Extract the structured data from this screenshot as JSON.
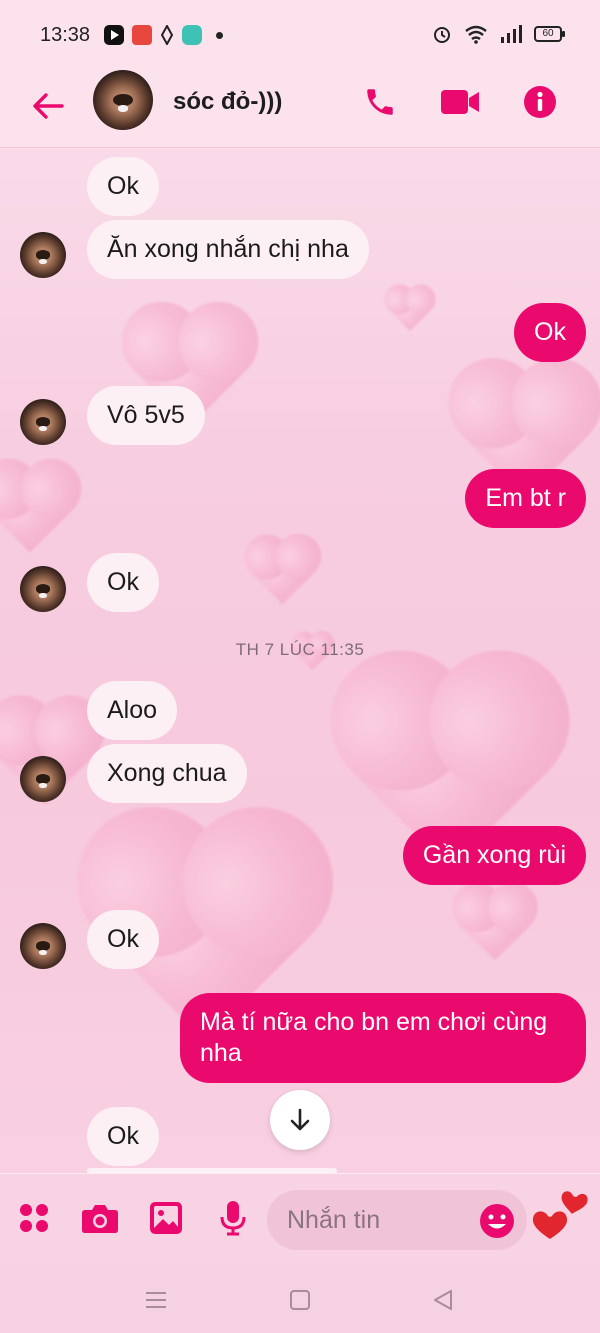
{
  "status_bar": {
    "time": "13:38",
    "battery": "60",
    "apps": [
      "youtube-icon",
      "mangatoon-icon",
      "vpn-icon",
      "telegram-icon"
    ]
  },
  "header": {
    "contact_name": "sóc đỏ-)))",
    "accent_color": "#ea0a6d"
  },
  "messages": [
    {
      "side": "received",
      "text": "Ok"
    },
    {
      "side": "received",
      "text": "Ăn xong nhắn chị nha"
    },
    {
      "side": "sent",
      "text": "Ok"
    },
    {
      "side": "received",
      "text": "Vô 5v5"
    },
    {
      "side": "sent",
      "text": "Em bt r"
    },
    {
      "side": "received",
      "text": "Ok"
    },
    {
      "side": "received",
      "text": "Aloo"
    },
    {
      "side": "received",
      "text": "Xong chua"
    },
    {
      "side": "sent",
      "text": "Gần xong rùi"
    },
    {
      "side": "received",
      "text": "Ok"
    },
    {
      "side": "sent",
      "text": "Mà tí nữa cho bn em chơi cùng nha",
      "lines": [
        "Mà tí nữa cho bn em chơi cùng",
        "nha"
      ]
    },
    {
      "side": "received",
      "text": "Ok"
    }
  ],
  "timestamp": "TH 7 LÚC 11:35",
  "composer": {
    "placeholder": "Nhắn tin"
  }
}
